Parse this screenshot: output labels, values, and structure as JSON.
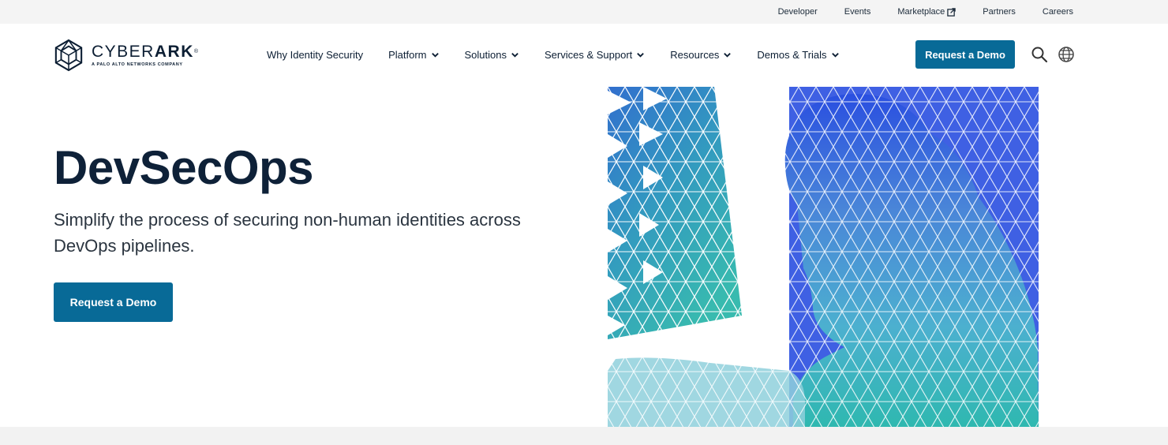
{
  "utility_nav": {
    "links": [
      "Developer",
      "Events",
      "Marketplace",
      "Partners",
      "Careers"
    ]
  },
  "brand": {
    "logo_word_light": "CYBER",
    "logo_word_bold": "ARK",
    "logo_mark_symbol": "®",
    "logo_tagline": "A PALO ALTO NETWORKS COMPANY"
  },
  "main_nav": {
    "items": [
      {
        "label": "Why Identity Security"
      },
      {
        "label": "Platform"
      },
      {
        "label": "Solutions"
      },
      {
        "label": "Services & Support"
      },
      {
        "label": "Resources"
      },
      {
        "label": "Demos & Trials"
      }
    ],
    "cta_label": "Request a Demo",
    "icons": [
      "search-icon",
      "globe-icon"
    ]
  },
  "hero": {
    "title": "DevSecOps",
    "subtitle": "Simplify the process of securing non-human identities across DevOps pipelines.",
    "cta_label": "Request a Demo"
  },
  "colors": {
    "brand_blue": "#086a97",
    "heading": "#0e2138",
    "utility_bg": "#f4f4f4"
  }
}
